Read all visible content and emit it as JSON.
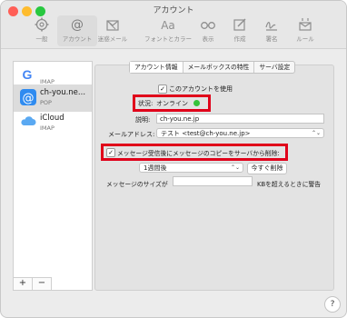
{
  "window": {
    "title": "アカウント"
  },
  "colors": {
    "traffic_close": "#ff5f57",
    "traffic_min": "#febc2e",
    "traffic_max": "#28c840",
    "status_online": "#36c33a",
    "highlight_box": "#e0001a"
  },
  "toolbar": {
    "items": [
      {
        "label": "一般",
        "icon": "gear-icon"
      },
      {
        "label": "アカウント",
        "icon": "at-sign-icon"
      },
      {
        "label": "迷惑メール",
        "icon": "junk-mail-icon"
      },
      {
        "label": "フォントとカラー",
        "icon": "font-icon"
      },
      {
        "label": "表示",
        "icon": "glasses-icon"
      },
      {
        "label": "作成",
        "icon": "compose-icon"
      },
      {
        "label": "署名",
        "icon": "signature-icon"
      },
      {
        "label": "ルール",
        "icon": "rules-icon"
      }
    ]
  },
  "sidebar": {
    "accounts": [
      {
        "name": "",
        "type": "IMAP",
        "icon": "google-icon"
      },
      {
        "name": "ch-you.ne...",
        "type": "POP",
        "icon": "at-sign-icon"
      },
      {
        "name": "iCloud",
        "type": "IMAP",
        "icon": "icloud-icon"
      }
    ],
    "add_label": "+",
    "remove_label": "−"
  },
  "tabs": [
    "アカウント情報",
    "メールボックスの特性",
    "サーバ設定"
  ],
  "account_info": {
    "enable_label": "このアカウントを使用",
    "status_label": "状況:",
    "status_value": "オンライン",
    "description_label": "説明:",
    "description_value": "ch-you.ne.jp",
    "email_label": "メールアドレス:",
    "email_value": "テスト <test@ch-you.ne.jp>",
    "remove_copy_label": "メッセージ受信後にメッセージのコピーをサーバから削除:",
    "remove_after_value": "1週間後",
    "remove_now_label": "今すぐ削除",
    "size_prefix": "メッセージのサイズが",
    "size_value": "",
    "size_suffix": "KBを超えるときに警告"
  },
  "help_label": "?"
}
